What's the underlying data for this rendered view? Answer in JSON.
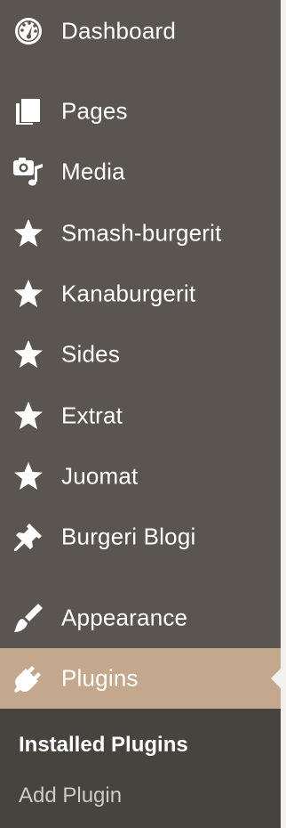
{
  "menu": {
    "items": [
      {
        "label": "Dashboard",
        "icon": "dashboard-icon"
      },
      {
        "label": "Pages",
        "icon": "pages-icon"
      },
      {
        "label": "Media",
        "icon": "media-icon"
      },
      {
        "label": "Smash-burgerit",
        "icon": "star-icon"
      },
      {
        "label": "Kanaburgerit",
        "icon": "star-icon"
      },
      {
        "label": "Sides",
        "icon": "star-icon"
      },
      {
        "label": "Extrat",
        "icon": "star-icon"
      },
      {
        "label": "Juomat",
        "icon": "star-icon"
      },
      {
        "label": "Burgeri Blogi",
        "icon": "pin-icon"
      },
      {
        "label": "Appearance",
        "icon": "paintbrush-icon"
      },
      {
        "label": "Plugins",
        "icon": "plugin-icon",
        "active": true
      }
    ]
  },
  "submenu": {
    "items": [
      {
        "label": "Installed Plugins",
        "current": true
      },
      {
        "label": "Add Plugin",
        "current": false
      }
    ]
  },
  "colors": {
    "sidebar_bg": "#5a5550",
    "active_bg": "#c4a88e",
    "submenu_bg": "#47433f",
    "text": "#ffffff",
    "submenu_text_muted": "#cfcac5"
  }
}
